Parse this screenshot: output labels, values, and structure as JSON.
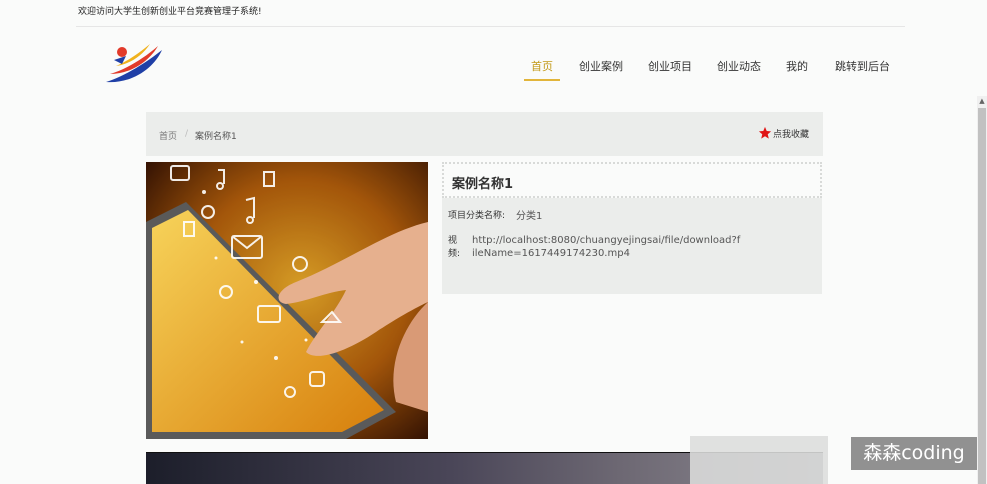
{
  "header": {
    "welcome_text": "欢迎访问大学生创新创业平台竞赛管理子系统!"
  },
  "nav": {
    "items": [
      {
        "label": "首页",
        "active": true
      },
      {
        "label": "创业案例",
        "active": false
      },
      {
        "label": "创业项目",
        "active": false
      },
      {
        "label": "创业动态",
        "active": false
      },
      {
        "label": "我的",
        "active": false
      },
      {
        "label": "跳转到后台",
        "active": false
      }
    ]
  },
  "breadcrumb": {
    "home": "首页",
    "separator": "/",
    "current": "案例名称1"
  },
  "favorite": {
    "label": "点我收藏",
    "icon": "star-icon",
    "color": "#e01515"
  },
  "detail": {
    "title": "案例名称1",
    "category_label": "项目分类名称:",
    "category_value": "分类1",
    "video_label": "视频:",
    "video_url": "http://localhost:8080/chuangyejingsai/file/download?fileName=1617449174230.mp4"
  },
  "watermark": "森森coding",
  "colors": {
    "accent": "#e2b53a",
    "panel": "#ebedeb"
  }
}
